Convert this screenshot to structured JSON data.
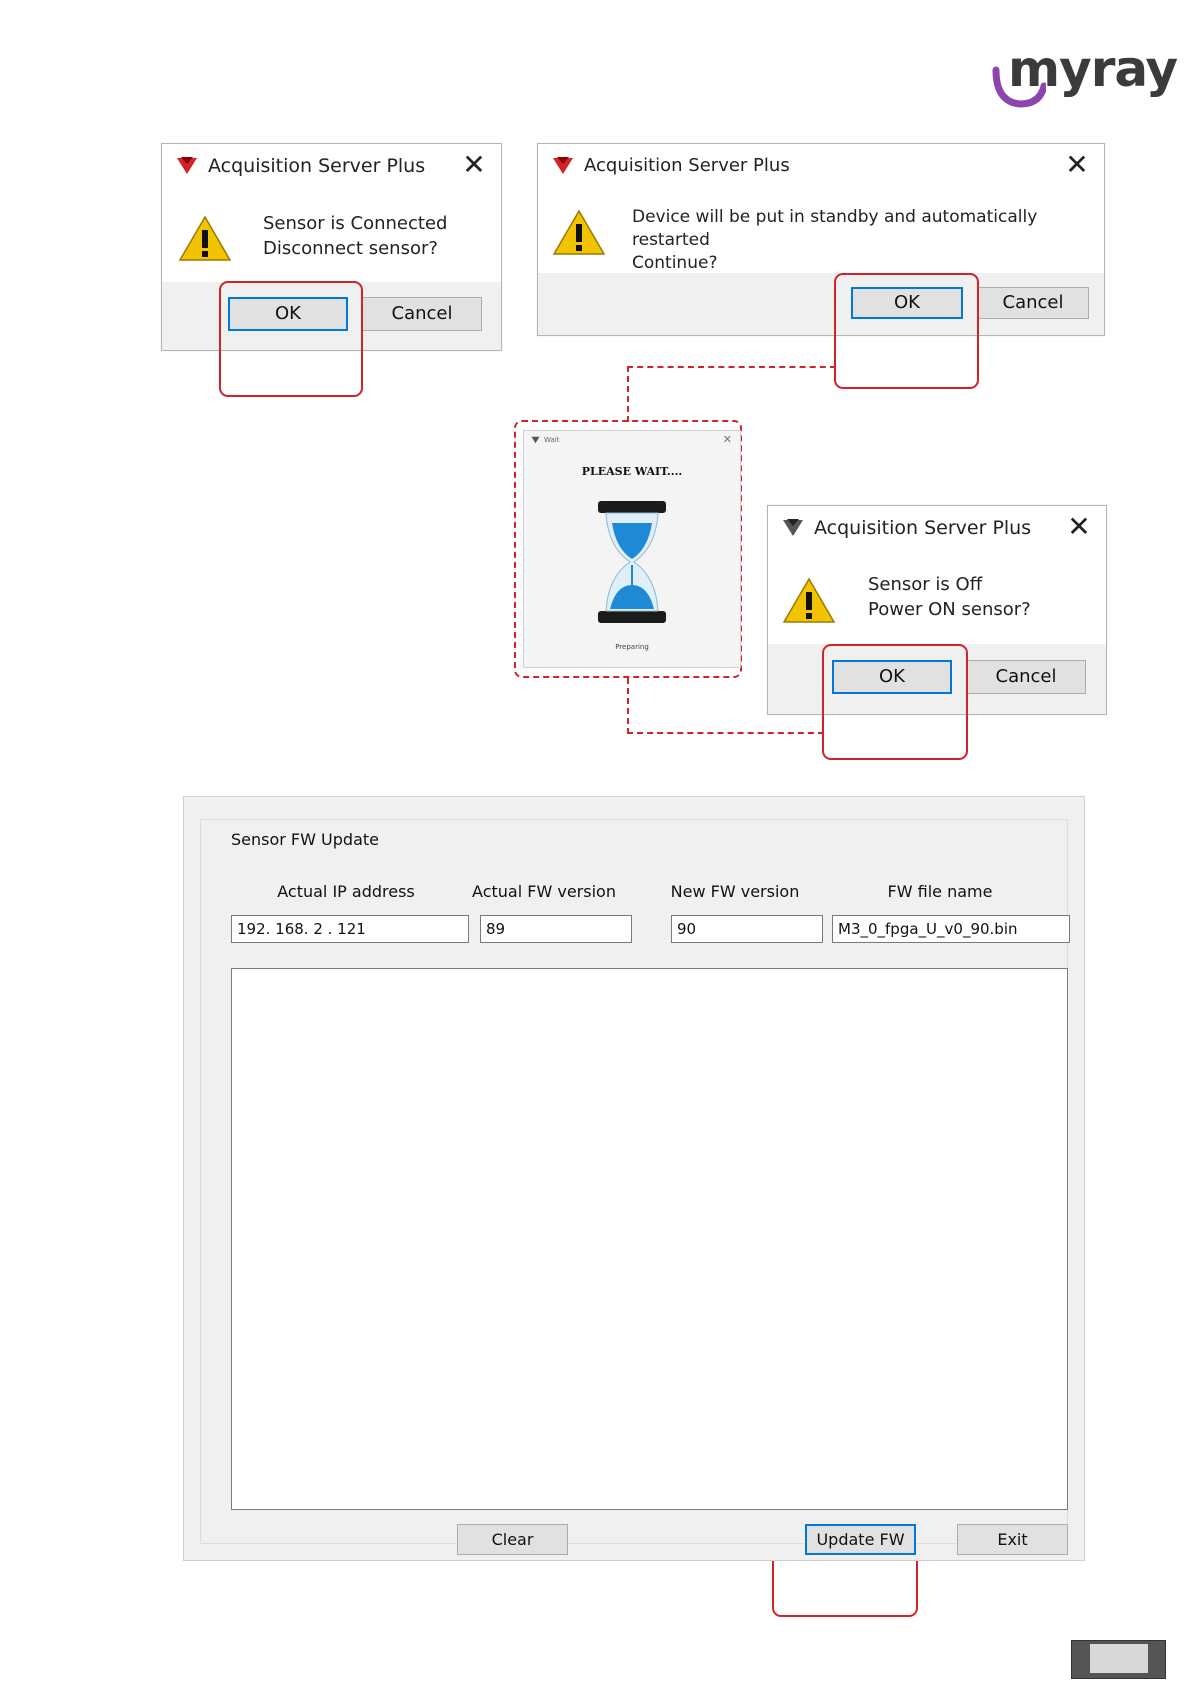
{
  "logo": {
    "text": "myray"
  },
  "dialog_disconnect": {
    "title": "Acquisition Server Plus",
    "line1": "Sensor is Connected",
    "line2": "Disconnect sensor?",
    "ok": "OK",
    "cancel": "Cancel"
  },
  "dialog_standby": {
    "title": "Acquisition Server Plus",
    "line1": "Device will be put in standby and automatically restarted",
    "line2": "Continue?",
    "ok": "OK",
    "cancel": "Cancel"
  },
  "wait_window": {
    "title": "Wait",
    "message": "PLEASE WAIT....",
    "status": "Preparing"
  },
  "dialog_poweron": {
    "title": "Acquisition Server Plus",
    "line1": "Sensor is Off",
    "line2": "Power ON sensor?",
    "ok": "OK",
    "cancel": "Cancel"
  },
  "fw_update": {
    "group_title": "Sensor FW Update",
    "columns": {
      "ip": "Actual IP address",
      "actual_fw": "Actual FW version",
      "new_fw": "New FW version",
      "file": "FW file name"
    },
    "values": {
      "ip": "192. 168. 2 . 121",
      "actual_fw": "89",
      "new_fw": "90",
      "file": "M3_0_fpga_U_v0_90.bin"
    },
    "buttons": {
      "clear": "Clear",
      "update": "Update FW",
      "exit": "Exit"
    }
  },
  "colors": {
    "highlight": "#d2232a",
    "default_button_border": "#0078d7",
    "logo_accent": "#8e44ad"
  }
}
